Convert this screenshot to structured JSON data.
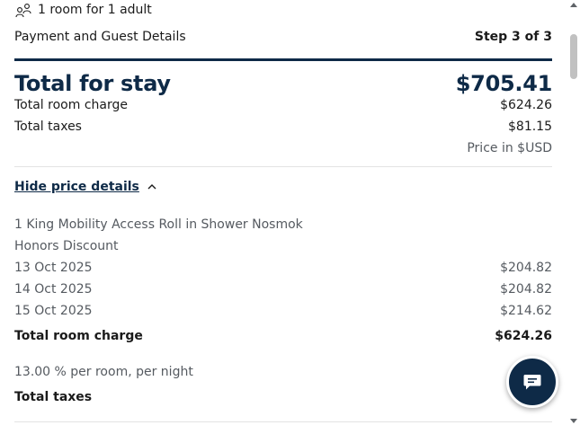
{
  "guests": {
    "label": "1 room for 1 adult",
    "icon": "guests-icon"
  },
  "step": {
    "title": "Payment and Guest Details",
    "indicator": "Step 3 of 3"
  },
  "summary": {
    "total_label": "Total for stay",
    "total_value": "$705.41",
    "room_charge_label": "Total room charge",
    "room_charge_value": "$624.26",
    "taxes_label": "Total taxes",
    "taxes_value": "$81.15",
    "currency_note": "Price in $USD"
  },
  "details_toggle": {
    "label": "Hide price details",
    "icon": "chevron-up-icon"
  },
  "details": {
    "room_type": "1 King Mobility Access Roll in Shower Nosmok",
    "rate_name": "Honors Discount",
    "nights": [
      {
        "date": "13 Oct 2025",
        "price": "$204.82"
      },
      {
        "date": "14 Oct 2025",
        "price": "$204.82"
      },
      {
        "date": "15 Oct 2025",
        "price": "$214.62"
      }
    ],
    "room_total_label": "Total room charge",
    "room_total_value": "$624.26",
    "tax_rate": "13.00 % per room, per night",
    "tax_total_label": "Total taxes"
  },
  "chat": {
    "icon": "chat-icon"
  },
  "colors": {
    "brand": "#0e2a47",
    "muted": "#555a60",
    "divider": "#e3e3e3"
  }
}
